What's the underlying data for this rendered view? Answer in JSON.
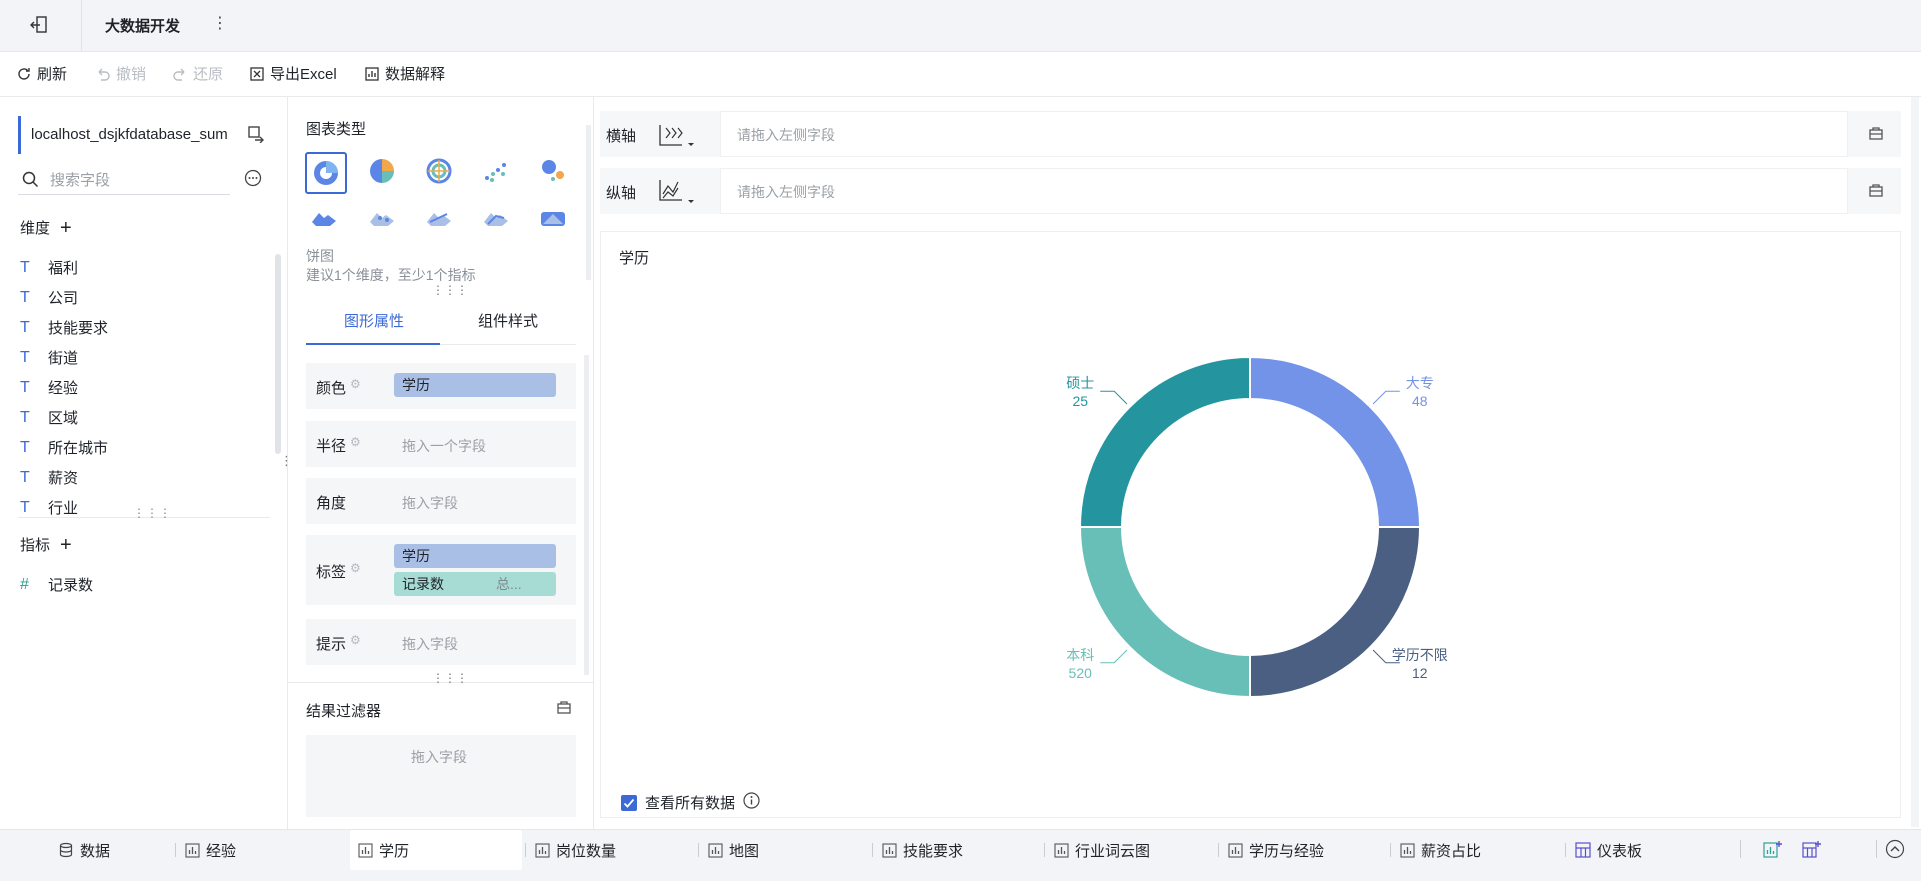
{
  "header": {
    "title": "大数据开发",
    "more_icon": "more-vertical-icon",
    "back_icon": "exit-icon"
  },
  "toolbar": {
    "refresh": "刷新",
    "undo": "撤销",
    "redo": "还原",
    "export": "导出Excel",
    "explain": "数据解释"
  },
  "left": {
    "datasource": "localhost_dsjkfdatabase_sum",
    "search_placeholder": "搜索字段",
    "dimensions_title": "维度",
    "dimensions": [
      "福利",
      "公司",
      "技能要求",
      "街道",
      "经验",
      "区域",
      "所在城市",
      "薪资",
      "行业"
    ],
    "measures_title": "指标",
    "measures": [
      "记录数"
    ]
  },
  "middle": {
    "chart_type_title": "图表类型",
    "chart_name": "饼图",
    "chart_hint": "建议1个维度，至少1个指标",
    "tab_props": "图形属性",
    "tab_style": "组件样式",
    "props": {
      "color_label": "颜色",
      "color_field": "学历",
      "radius_label": "半径",
      "radius_ph": "拖入一个字段",
      "angle_label": "角度",
      "angle_ph": "拖入字段",
      "label_label": "标签",
      "label_field1": "学历",
      "label_field2": "记录数",
      "label_field2_agg": "总...",
      "tip_label": "提示",
      "tip_ph": "拖入字段"
    },
    "filter_title": "结果过滤器",
    "filter_ph": "拖入字段"
  },
  "axes": {
    "x_label": "横轴",
    "y_label": "纵轴",
    "placeholder": "请拖入左侧字段"
  },
  "chart": {
    "view_all": "查看所有数据"
  },
  "chart_data": {
    "type": "pie",
    "title": "学历",
    "donut": true,
    "slices": [
      {
        "label": "大专",
        "value": 48,
        "color": "#7393e8"
      },
      {
        "label": "学历不限",
        "value": 12,
        "color": "#4a5f82"
      },
      {
        "label": "本科",
        "value": 520,
        "color": "#68bfb8"
      },
      {
        "label": "硕士",
        "value": 25,
        "color": "#24959f"
      }
    ]
  },
  "bottom_tabs": [
    "数据",
    "经验",
    "学历",
    "岗位数量",
    "地图",
    "技能要求",
    "行业词云图",
    "学历与经验",
    "薪资占比",
    "仪表板"
  ],
  "colors": {
    "accent": "#3b6ad6",
    "pill_blue": "#a9bfe6",
    "pill_teal": "#a6dcd3"
  }
}
